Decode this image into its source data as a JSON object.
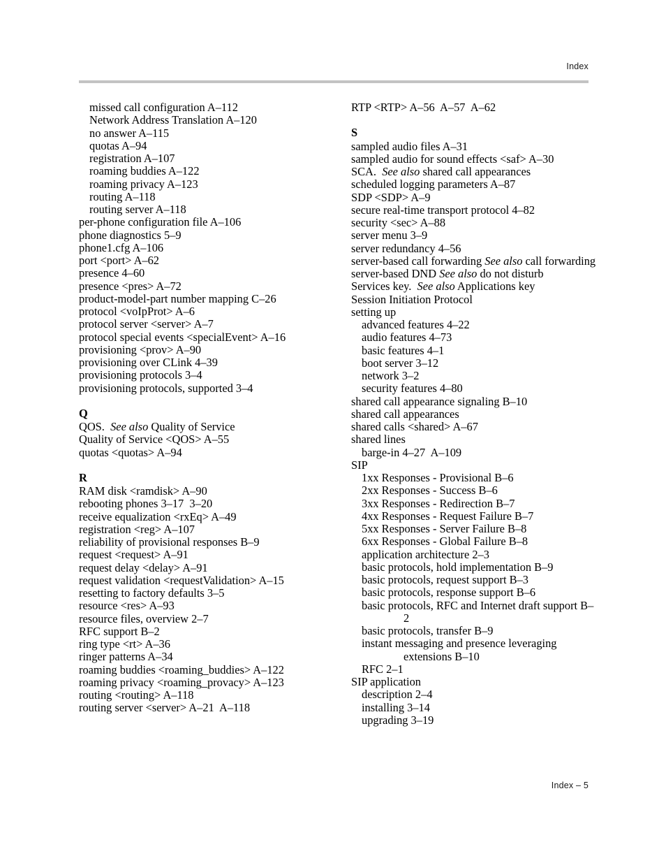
{
  "header": {
    "running_head": "Index"
  },
  "footer": {
    "folio": "Index – 5"
  },
  "colors": {
    "rule": "#c3c3c3",
    "text": "#000000"
  },
  "columns": {
    "left": [
      {
        "type": "entry",
        "level": 2,
        "text": "missed call configuration A–112"
      },
      {
        "type": "entry",
        "level": 2,
        "text": "Network Address Translation A–120"
      },
      {
        "type": "entry",
        "level": 2,
        "text": "no answer A–115"
      },
      {
        "type": "entry",
        "level": 2,
        "text": "quotas A–94"
      },
      {
        "type": "entry",
        "level": 2,
        "text": "registration A–107"
      },
      {
        "type": "entry",
        "level": 2,
        "text": "roaming buddies A–122"
      },
      {
        "type": "entry",
        "level": 2,
        "text": "roaming privacy A–123"
      },
      {
        "type": "entry",
        "level": 2,
        "text": "routing A–118"
      },
      {
        "type": "entry",
        "level": 2,
        "text": "routing server A–118"
      },
      {
        "type": "entry",
        "level": 1,
        "text": "per-phone configuration file A–106"
      },
      {
        "type": "entry",
        "level": 1,
        "text": "phone diagnostics 5–9"
      },
      {
        "type": "entry",
        "level": 1,
        "text": "phone1.cfg A–106"
      },
      {
        "type": "entry",
        "level": 1,
        "text": "port <port> A–62"
      },
      {
        "type": "entry",
        "level": 1,
        "text": "presence 4–60"
      },
      {
        "type": "entry",
        "level": 1,
        "text": "presence <pres> A–72"
      },
      {
        "type": "entry",
        "level": 1,
        "text": "product-model-part number mapping C–26"
      },
      {
        "type": "entry",
        "level": 1,
        "text": "protocol <voIpProt> A–6"
      },
      {
        "type": "entry",
        "level": 1,
        "text": "protocol server <server> A–7"
      },
      {
        "type": "entry",
        "level": 1,
        "text": "protocol special events <specialEvent> A–16"
      },
      {
        "type": "entry",
        "level": 1,
        "text": "provisioning <prov> A–90"
      },
      {
        "type": "entry",
        "level": 1,
        "text": "provisioning over CLink 4–39"
      },
      {
        "type": "entry",
        "level": 1,
        "text": "provisioning protocols 3–4"
      },
      {
        "type": "entry",
        "level": 1,
        "text": "provisioning protocols, supported 3–4"
      },
      {
        "type": "letter",
        "text": "Q"
      },
      {
        "type": "entry",
        "level": 1,
        "pre": "QOS.  ",
        "italic": "See also",
        "post": " Quality of Service"
      },
      {
        "type": "entry",
        "level": 1,
        "text": "Quality of Service <QOS> A–55"
      },
      {
        "type": "entry",
        "level": 1,
        "text": "quotas <quotas> A–94"
      },
      {
        "type": "letter",
        "text": "R"
      },
      {
        "type": "entry",
        "level": 1,
        "text": "RAM disk <ramdisk> A–90"
      },
      {
        "type": "entry",
        "level": 1,
        "text": "rebooting phones 3–17  3–20"
      },
      {
        "type": "entry",
        "level": 1,
        "text": "receive equalization <rxEq> A–49"
      },
      {
        "type": "entry",
        "level": 1,
        "text": "registration <reg> A–107"
      },
      {
        "type": "entry",
        "level": 1,
        "text": "reliability of provisional responses B–9"
      },
      {
        "type": "entry",
        "level": 1,
        "text": "request <request> A–91"
      },
      {
        "type": "entry",
        "level": 1,
        "text": "request delay <delay> A–91"
      },
      {
        "type": "entry",
        "level": 1,
        "text": "request validation <requestValidation> A–15"
      },
      {
        "type": "entry",
        "level": 1,
        "text": "resetting to factory defaults 3–5"
      },
      {
        "type": "entry",
        "level": 1,
        "text": "resource <res> A–93"
      },
      {
        "type": "entry",
        "level": 1,
        "text": "resource files, overview 2–7"
      },
      {
        "type": "entry",
        "level": 1,
        "text": "RFC support B–2"
      },
      {
        "type": "entry",
        "level": 1,
        "text": "ring type <rt> A–36"
      },
      {
        "type": "entry",
        "level": 1,
        "text": "ringer patterns A–34"
      },
      {
        "type": "entry",
        "level": 1,
        "text": "roaming buddies <roaming_buddies> A–122"
      },
      {
        "type": "entry",
        "level": 1,
        "text": "roaming privacy <roaming_provacy> A–123"
      },
      {
        "type": "entry",
        "level": 1,
        "text": "routing <routing> A–118"
      },
      {
        "type": "entry",
        "level": 1,
        "text": "routing server <server> A–21  A–118"
      }
    ],
    "right": [
      {
        "type": "entry",
        "level": 1,
        "text": "RTP <RTP> A–56  A–57  A–62"
      },
      {
        "type": "letter",
        "text": "S"
      },
      {
        "type": "entry",
        "level": 1,
        "text": "sampled audio files A–31"
      },
      {
        "type": "entry",
        "level": 1,
        "text": "sampled audio for sound effects <saf> A–30"
      },
      {
        "type": "entry",
        "level": 1,
        "pre": "SCA.  ",
        "italic": "See also",
        "post": " shared call appearances"
      },
      {
        "type": "entry",
        "level": 1,
        "text": "scheduled logging parameters A–87"
      },
      {
        "type": "entry",
        "level": 1,
        "text": "SDP <SDP> A–9"
      },
      {
        "type": "entry",
        "level": 1,
        "text": "secure real-time transport protocol 4–82"
      },
      {
        "type": "entry",
        "level": 1,
        "text": "security <sec> A–88"
      },
      {
        "type": "entry",
        "level": 1,
        "text": "server menu 3–9"
      },
      {
        "type": "entry",
        "level": 1,
        "text": "server redundancy 4–56"
      },
      {
        "type": "entry",
        "level": 1,
        "wrap": true,
        "pre": "server-based call forwarding ",
        "italic": "See also",
        "post": " call forwarding"
      },
      {
        "type": "entry",
        "level": 1,
        "pre": "server-based DND ",
        "italic": "See also",
        "post": " do not disturb"
      },
      {
        "type": "entry",
        "level": 1,
        "pre": "Services key.  ",
        "italic": "See also",
        "post": " Applications key"
      },
      {
        "type": "entry",
        "level": 1,
        "text": "Session Initiation Protocol"
      },
      {
        "type": "entry",
        "level": 1,
        "text": "setting up"
      },
      {
        "type": "entry",
        "level": 2,
        "text": "advanced features 4–22"
      },
      {
        "type": "entry",
        "level": 2,
        "text": "audio features 4–73"
      },
      {
        "type": "entry",
        "level": 2,
        "text": "basic features 4–1"
      },
      {
        "type": "entry",
        "level": 2,
        "text": "boot server 3–12"
      },
      {
        "type": "entry",
        "level": 2,
        "text": "network 3–2"
      },
      {
        "type": "entry",
        "level": 2,
        "text": "security features 4–80"
      },
      {
        "type": "entry",
        "level": 1,
        "text": "shared call appearance signaling B–10"
      },
      {
        "type": "entry",
        "level": 1,
        "text": "shared call appearances"
      },
      {
        "type": "entry",
        "level": 1,
        "text": "shared calls <shared> A–67"
      },
      {
        "type": "entry",
        "level": 1,
        "text": "shared lines"
      },
      {
        "type": "entry",
        "level": 2,
        "text": "barge-in 4–27  A–109"
      },
      {
        "type": "entry",
        "level": 1,
        "text": "SIP"
      },
      {
        "type": "entry",
        "level": 2,
        "text": "1xx Responses - Provisional B–6"
      },
      {
        "type": "entry",
        "level": 2,
        "text": "2xx Responses - Success B–6"
      },
      {
        "type": "entry",
        "level": 2,
        "text": "3xx Responses - Redirection B–7"
      },
      {
        "type": "entry",
        "level": 2,
        "text": "4xx Responses - Request Failure B–7"
      },
      {
        "type": "entry",
        "level": 2,
        "text": "5xx Responses - Server Failure B–8"
      },
      {
        "type": "entry",
        "level": 2,
        "text": "6xx Responses - Global Failure B–8"
      },
      {
        "type": "entry",
        "level": 2,
        "text": "application architecture 2–3"
      },
      {
        "type": "entry",
        "level": 2,
        "text": "basic protocols, hold implementation B–9"
      },
      {
        "type": "entry",
        "level": 2,
        "text": "basic protocols, request support B–3"
      },
      {
        "type": "entry",
        "level": 2,
        "text": "basic protocols, response support B–6"
      },
      {
        "type": "entry",
        "level": 2,
        "wrap": true,
        "text": "basic protocols, RFC and Internet draft support B–2"
      },
      {
        "type": "entry",
        "level": 2,
        "text": "basic protocols, transfer B–9"
      },
      {
        "type": "entry",
        "level": 2,
        "wrap": true,
        "text": "instant messaging and presence leveraging extensions B–10"
      },
      {
        "type": "entry",
        "level": 2,
        "text": "RFC 2–1"
      },
      {
        "type": "entry",
        "level": 1,
        "text": "SIP application"
      },
      {
        "type": "entry",
        "level": 2,
        "text": "description 2–4"
      },
      {
        "type": "entry",
        "level": 2,
        "text": "installing 3–14"
      },
      {
        "type": "entry",
        "level": 2,
        "text": "upgrading 3–19"
      }
    ]
  }
}
